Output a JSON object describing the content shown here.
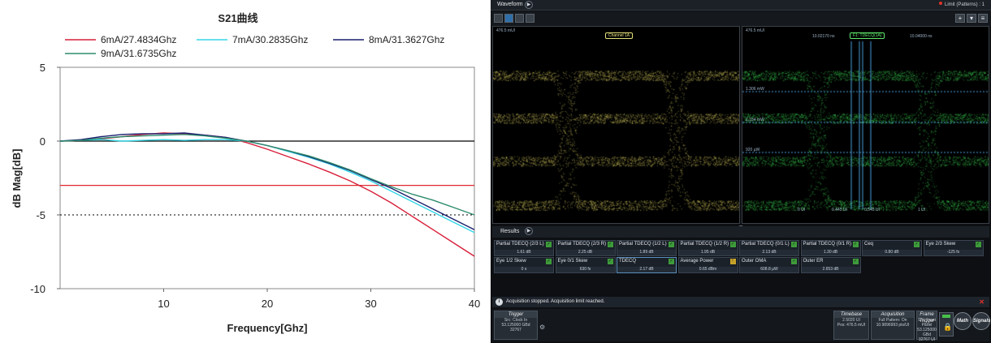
{
  "chart_data": {
    "type": "line",
    "title": "S21曲线",
    "xlabel": "Frequency[Ghz]",
    "ylabel": "dB Mag[dB]",
    "xlim": [
      0,
      40
    ],
    "ylim": [
      -10,
      5
    ],
    "xticks": [
      10,
      20,
      30,
      40
    ],
    "yticks": [
      5,
      0,
      -5,
      -10
    ],
    "legend_position": "top",
    "reference_lines": [
      {
        "y": 0,
        "color": "#000000",
        "style": "solid"
      },
      {
        "y": -3,
        "color": "#e0292e",
        "style": "solid"
      },
      {
        "y": -5,
        "color": "#000000",
        "style": "dotted"
      }
    ],
    "series": [
      {
        "name": "6mA/27.4834Ghz",
        "color": "#d81f3a",
        "x": [
          0,
          2,
          4,
          6,
          8,
          10,
          12,
          14,
          16,
          18,
          20,
          22,
          24,
          26,
          28,
          30,
          32,
          34,
          36,
          38,
          40
        ],
        "y": [
          0.0,
          0.05,
          0.15,
          0.3,
          0.45,
          0.55,
          0.5,
          0.4,
          0.25,
          -0.1,
          -0.55,
          -1.05,
          -1.55,
          -2.1,
          -2.7,
          -3.4,
          -4.2,
          -5.1,
          -6.0,
          -6.9,
          -7.8
        ]
      },
      {
        "name": "7mA/30.2835Ghz",
        "color": "#33d6e6",
        "x": [
          0,
          2,
          4,
          6,
          8,
          10,
          12,
          14,
          16,
          18,
          20,
          22,
          24,
          26,
          28,
          30,
          32,
          34,
          36,
          38,
          40
        ],
        "y": [
          0.0,
          0.05,
          0.1,
          0.0,
          0.05,
          0.1,
          0.05,
          0.1,
          0.1,
          0.0,
          -0.3,
          -0.7,
          -1.1,
          -1.55,
          -2.1,
          -2.7,
          -3.4,
          -4.1,
          -4.8,
          -5.5,
          -6.2
        ]
      },
      {
        "name": "8mA/31.3627Ghz",
        "color": "#1a1f6e",
        "x": [
          0,
          2,
          4,
          6,
          8,
          10,
          12,
          14,
          16,
          18,
          20,
          22,
          24,
          26,
          28,
          30,
          32,
          34,
          36,
          38,
          40
        ],
        "y": [
          0.0,
          0.1,
          0.3,
          0.45,
          0.5,
          0.5,
          0.55,
          0.4,
          0.25,
          0.0,
          -0.3,
          -0.65,
          -1.05,
          -1.5,
          -2.0,
          -2.6,
          -3.2,
          -3.9,
          -4.6,
          -5.3,
          -6.0
        ]
      },
      {
        "name": "9mA/31.6735Ghz",
        "color": "#2e8b6e",
        "x": [
          0,
          2,
          4,
          6,
          8,
          10,
          12,
          14,
          16,
          18,
          20,
          22,
          24,
          26,
          28,
          30,
          32,
          34,
          36,
          38,
          40
        ],
        "y": [
          0.0,
          0.05,
          0.2,
          0.3,
          0.35,
          0.4,
          0.45,
          0.35,
          0.2,
          0.0,
          -0.3,
          -0.65,
          -1.0,
          -1.45,
          -1.95,
          -2.55,
          -3.1,
          -3.6,
          -4.0,
          -4.5,
          -5.0
        ]
      }
    ]
  },
  "scope": {
    "title": "Waveform",
    "limit_text": "Limit (Patterns) : 1",
    "pane_a": {
      "scale": "476.5 mUI",
      "badge": "Channel 1A"
    },
    "pane_b": {
      "scale": "476.5 mUI",
      "badge": "F1: TDECQ(1A)",
      "time_left": "10.02170 ns",
      "time_right": "10.04000 ns",
      "level_1": "1.306 mW",
      "level_2": "1.154 mW",
      "level_3": "920 µW",
      "ui_0": "0 UI",
      "ui_1": "0.445 UI",
      "ui_2": "0.545 UI",
      "ui_3": "1 UI"
    },
    "results_title": "Results",
    "results": [
      {
        "name": "Partial TDECQ (2/3 L)",
        "value": "1.61 dB",
        "status": "pass"
      },
      {
        "name": "Partial TDECQ (2/3 R)",
        "value": "2.25 dB",
        "status": "pass"
      },
      {
        "name": "Partial TDECQ (1/2 L)",
        "value": "1.89 dB",
        "status": "pass"
      },
      {
        "name": "Partial TDECQ (1/2 R)",
        "value": "1.95 dB",
        "status": "pass"
      },
      {
        "name": "Partial TDECQ (0/1 L)",
        "value": "2.13 dB",
        "status": "pass"
      },
      {
        "name": "Partial TDECQ (0/1 R)",
        "value": "1.30 dB",
        "status": "pass"
      },
      {
        "name": "Ceq",
        "value": "0.80 dB",
        "status": "pass"
      },
      {
        "name": "Eye 2/3 Skew",
        "value": "-125 fs",
        "status": "pass"
      },
      {
        "name": "Eye 1/2 Skew",
        "value": "0 s",
        "status": "pass"
      },
      {
        "name": "Eye 0/1 Skew",
        "value": "630 fs",
        "status": "pass"
      },
      {
        "name": "TDECQ",
        "value": "2.17 dB",
        "status": "pass"
      },
      {
        "name": "Average Power",
        "value": "0.65 dBm",
        "status": "warn"
      },
      {
        "name": "Outer OMA",
        "value": "608.8 µW",
        "status": "pass"
      },
      {
        "name": "Outer ER",
        "value": "2.653 dB",
        "status": "pass"
      }
    ],
    "status_text": "Acquisition stopped. Acquisition limit reached.",
    "trigger": {
      "title": "Trigger",
      "l1": "Src: Clock In",
      "l2": "53.125000 GBd",
      "l3": "32767"
    },
    "timebase": {
      "title": "Timebase",
      "l1": "2.5020 UI",
      "l2": "Pos: 476.5 mUI"
    },
    "acquisition": {
      "title": "Acquisition",
      "l1": "Full Pattern: On",
      "l2": "10.9896993 pts/UI"
    },
    "frame_trigger": {
      "title": "Frame Trigger",
      "l1": "Src: Front Panel",
      "l2": "53.125000 GBd",
      "l3": "32767 UI"
    },
    "buttons": {
      "math": "Math",
      "signals": "Signals"
    },
    "colors": {
      "eye_a": "#e6e27a",
      "eye_b": "#5ee86a",
      "accent": "#2f6ea8",
      "pass": "#3e9b3a",
      "warn": "#c9a42a"
    }
  }
}
